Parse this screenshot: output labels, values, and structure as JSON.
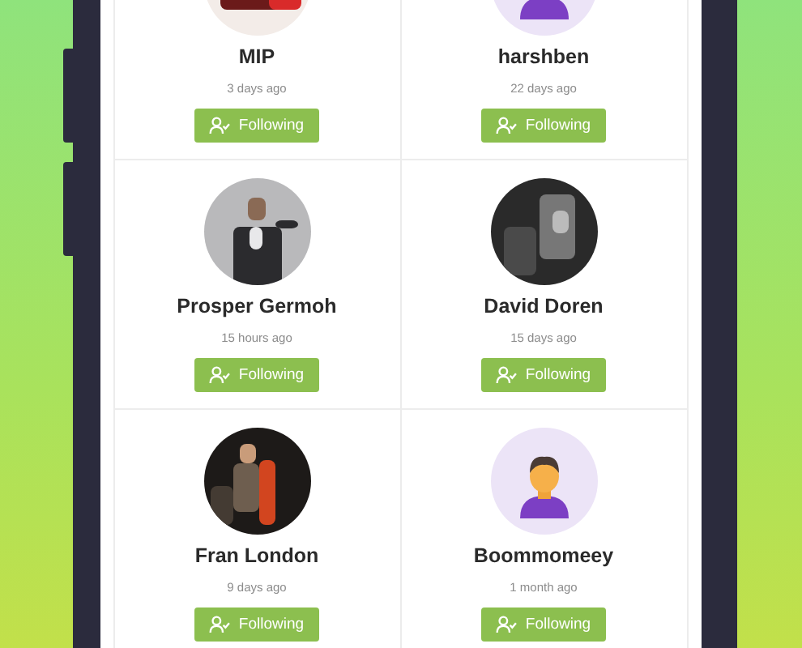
{
  "users": [
    {
      "name": "MIP",
      "time": "3 days ago",
      "button": "Following"
    },
    {
      "name": "harshben",
      "time": "22 days ago",
      "avatar": {
        "kind": "default"
      },
      "button": "Following"
    },
    {
      "name": "Prosper Germoh",
      "time": "15 hours ago",
      "button": "Following"
    },
    {
      "name": "David Doren",
      "time": "15 days ago",
      "button": "Following"
    },
    {
      "name": "Fran London",
      "time": "9 days ago",
      "button": "Following"
    },
    {
      "name": "Boommomeey",
      "time": "1 month ago",
      "avatar": {
        "kind": "default"
      },
      "button": "Following"
    }
  ]
}
